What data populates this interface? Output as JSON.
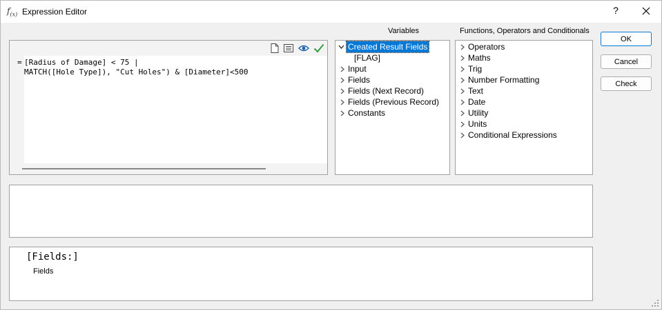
{
  "window": {
    "title": "Expression Editor",
    "icon_text": "f",
    "icon_sub": "(x)",
    "help_label": "?",
    "close_icon": "close-icon"
  },
  "editor": {
    "prefix": "=",
    "lines": [
      "[Radius of Damage] < 75 |",
      "MATCH([Hole Type]), \"Cut Holes\") & [Diameter]<500"
    ],
    "toolbar_icons": [
      "new-document-icon",
      "list-icon",
      "preview-eye-icon",
      "validate-check-icon"
    ]
  },
  "variables": {
    "heading": "Variables",
    "items": [
      {
        "label": "Created Result Fields",
        "expanded": true,
        "selected": true
      },
      {
        "label": "[FLAG]",
        "child": true
      },
      {
        "label": "Input"
      },
      {
        "label": "Fields"
      },
      {
        "label": "Fields (Next Record)"
      },
      {
        "label": "Fields (Previous Record)"
      },
      {
        "label": "Constants"
      }
    ]
  },
  "functions": {
    "heading": "Functions, Operators and Conditionals",
    "items": [
      {
        "label": "Operators"
      },
      {
        "label": "Maths"
      },
      {
        "label": "Trig"
      },
      {
        "label": "Number Formatting"
      },
      {
        "label": "Text"
      },
      {
        "label": "Date"
      },
      {
        "label": "Utility"
      },
      {
        "label": "Units"
      },
      {
        "label": "Conditional Expressions"
      }
    ]
  },
  "buttons": {
    "ok": "OK",
    "cancel": "Cancel",
    "check": "Check"
  },
  "help": {
    "title": "[Fields:]",
    "body": "Fields"
  },
  "colors": {
    "accent": "#0078d7",
    "check": "#2e9e3e",
    "eye": "#1d5fa8"
  }
}
